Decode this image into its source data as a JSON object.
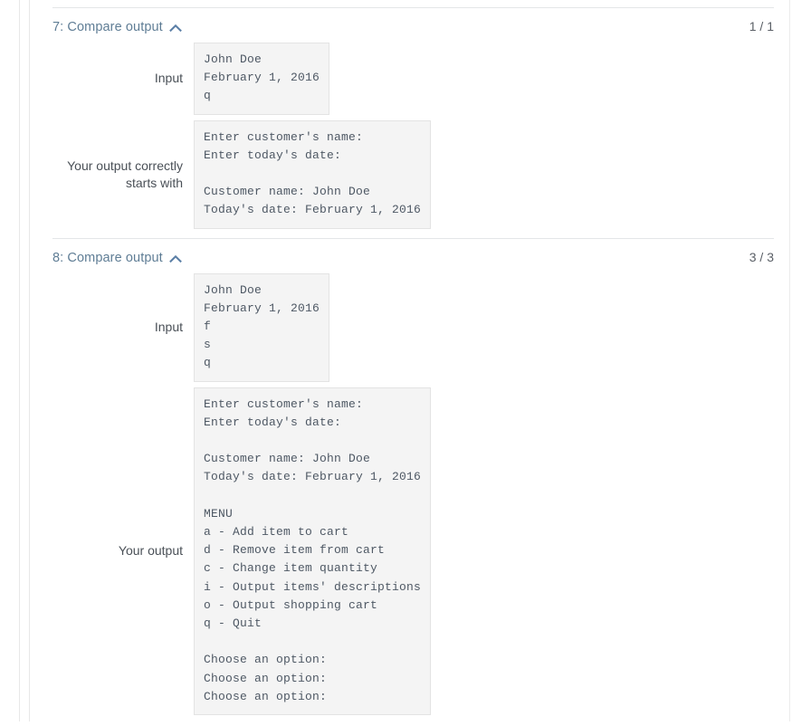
{
  "colors": {
    "header_text": "#5f7d95",
    "body_text": "#4a5057",
    "code_bg": "#f4f4f4",
    "code_border": "#e3e3e3",
    "divider": "#e4e6e8",
    "score_text": "#5a5f66"
  },
  "test_cases": [
    {
      "id": "case-7",
      "title": "7: Compare output",
      "collapse_icon": "chevron-up-icon",
      "score": "1 / 1",
      "rows": [
        {
          "name": "input",
          "label": "Input",
          "text": "John Doe\nFebruary 1, 2016\nq"
        },
        {
          "name": "your-output-starts-with",
          "label": "Your output correctly\nstarts with",
          "text": "Enter customer's name:\nEnter today's date:\n\nCustomer name: John Doe\nToday's date: February 1, 2016"
        }
      ]
    },
    {
      "id": "case-8",
      "title": "8: Compare output",
      "collapse_icon": "chevron-up-icon",
      "score": "3 / 3",
      "rows": [
        {
          "name": "input",
          "label": "Input",
          "text": "John Doe\nFebruary 1, 2016\nf\ns\nq"
        },
        {
          "name": "your-output",
          "label": "Your output",
          "text": "Enter customer's name:\nEnter today's date:\n\nCustomer name: John Doe\nToday's date: February 1, 2016\n\nMENU\na - Add item to cart\nd - Remove item from cart\nc - Change item quantity\ni - Output items' descriptions\no - Output shopping cart\nq - Quit\n\nChoose an option:\nChoose an option:\nChoose an option:"
        }
      ]
    }
  ]
}
